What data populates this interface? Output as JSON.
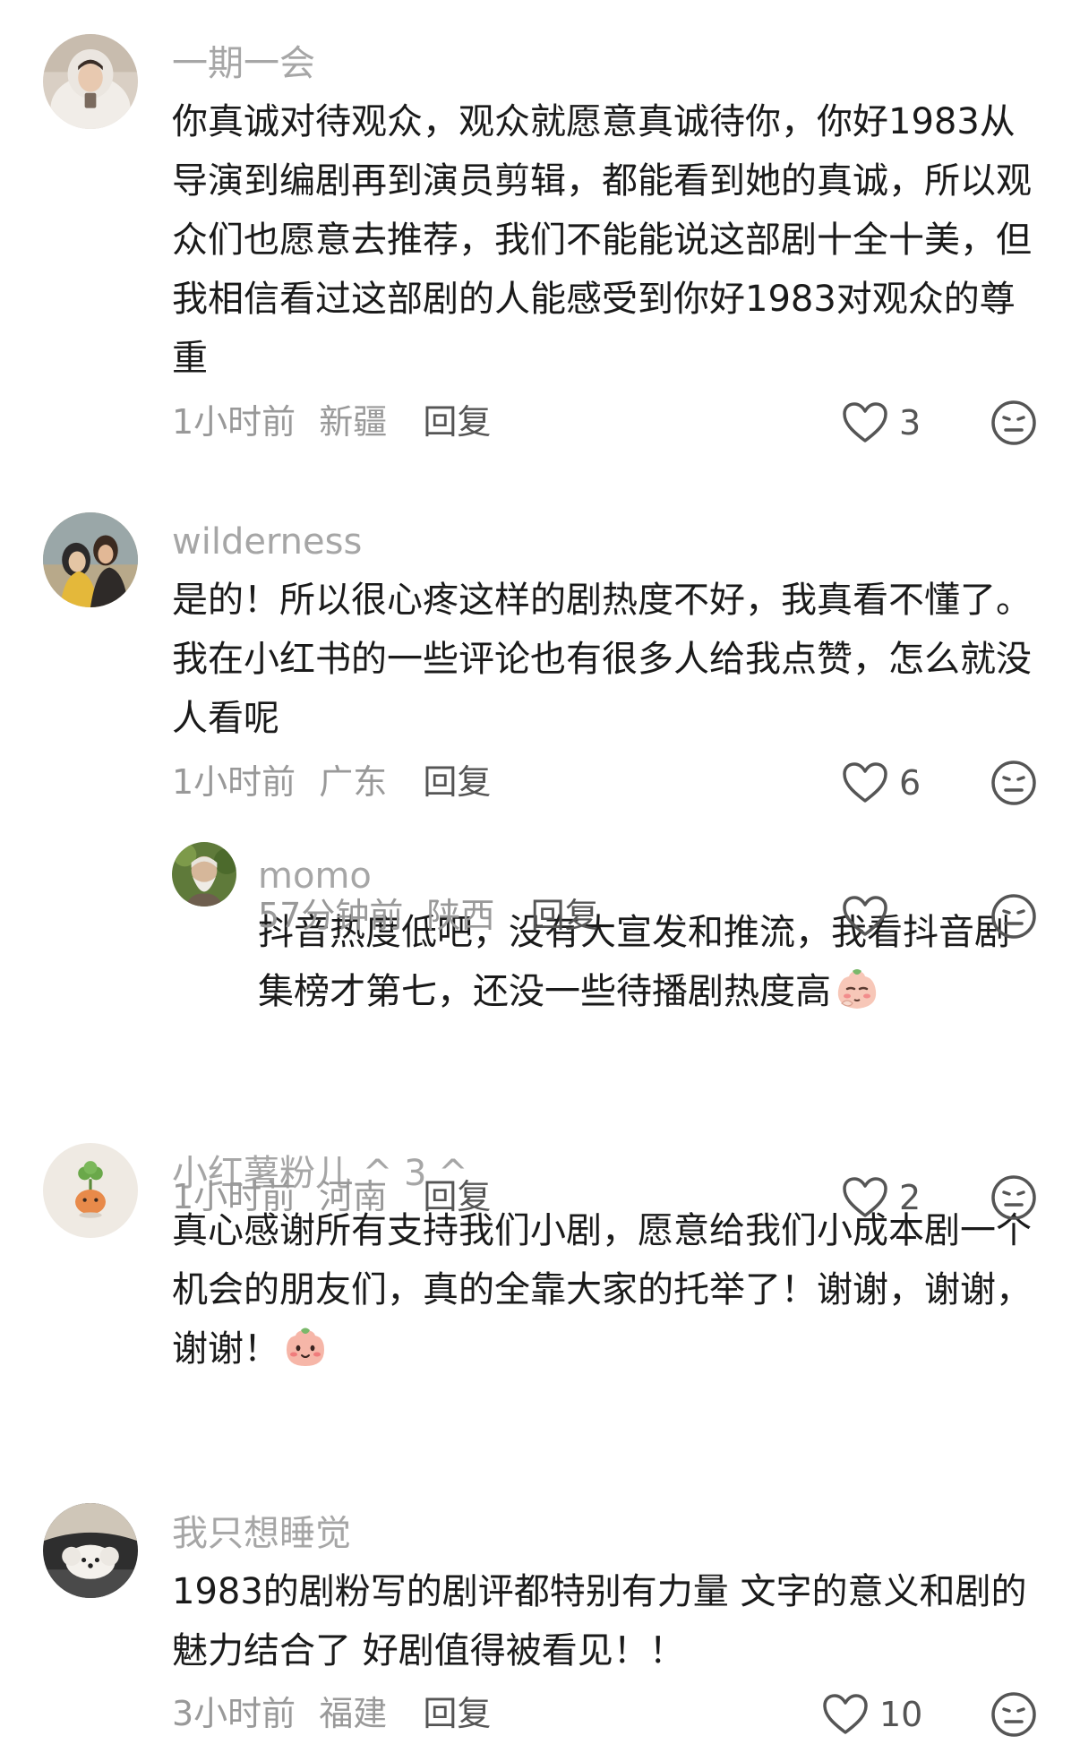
{
  "comments": [
    {
      "username": "一期一会",
      "text": "你真诚对待观众，观众就愿意真诚待你，你好1983从导演到编剧再到演员剪辑，都能看到她的真诚，所以观众们也愿意去推荐，我们不能能说这部剧十全十美，但我相信看过这部剧的人能感受到你好1983对观众的尊重",
      "time": "1小时前",
      "location": "新疆",
      "reply_label": "回复",
      "likes": "3",
      "avatar_icon": "person-in-white-hoodie-avatar"
    },
    {
      "username": "wilderness",
      "text": "是的！所以很心疼这样的剧热度不好，我真看不懂了。我在小红书的一些评论也有很多人给我点赞，怎么就没人看呢",
      "time": "1小时前",
      "location": "广东",
      "reply_label": "回复",
      "likes": "6",
      "avatar_icon": "painting-couple-avatar"
    },
    {
      "username": "momo",
      "text": "抖音热度低吧，没有大宣发和推流，我看抖音剧集榜才第七，还没一些待播剧热度高",
      "emoji": "pensive-face-emoji",
      "time": "57分钟前",
      "location": "陕西",
      "reply_label": "回复",
      "likes": "",
      "avatar_icon": "bearded-old-man-avatar"
    },
    {
      "username": "小红薯粉儿 ^ 3 ^",
      "text": "真心感谢所有支持我们小剧，愿意给我们小成本剧一个机会的朋友们，真的全靠大家的托举了！谢谢，谢谢，谢谢！",
      "emoji": "blushing-face-emoji",
      "time": "1小时前",
      "location": "河南",
      "reply_label": "回复",
      "likes": "2",
      "avatar_icon": "clover-sprout-avatar"
    },
    {
      "username": "我只想睡觉",
      "text": "1983的剧粉写的剧评都特别有力量 文字的意义和剧的魅力结合了 好剧值得被看见！！",
      "time": "3小时前",
      "location": "福建",
      "reply_label": "回复",
      "likes": "10",
      "avatar_icon": "white-dog-avatar"
    }
  ],
  "icons": {
    "like": "heart-outline-icon",
    "dislike": "neutral-face-icon"
  },
  "colors": {
    "username": "#a6a6a6",
    "meta": "#999999",
    "text": "#1a1a1a",
    "icon": "#555555"
  }
}
